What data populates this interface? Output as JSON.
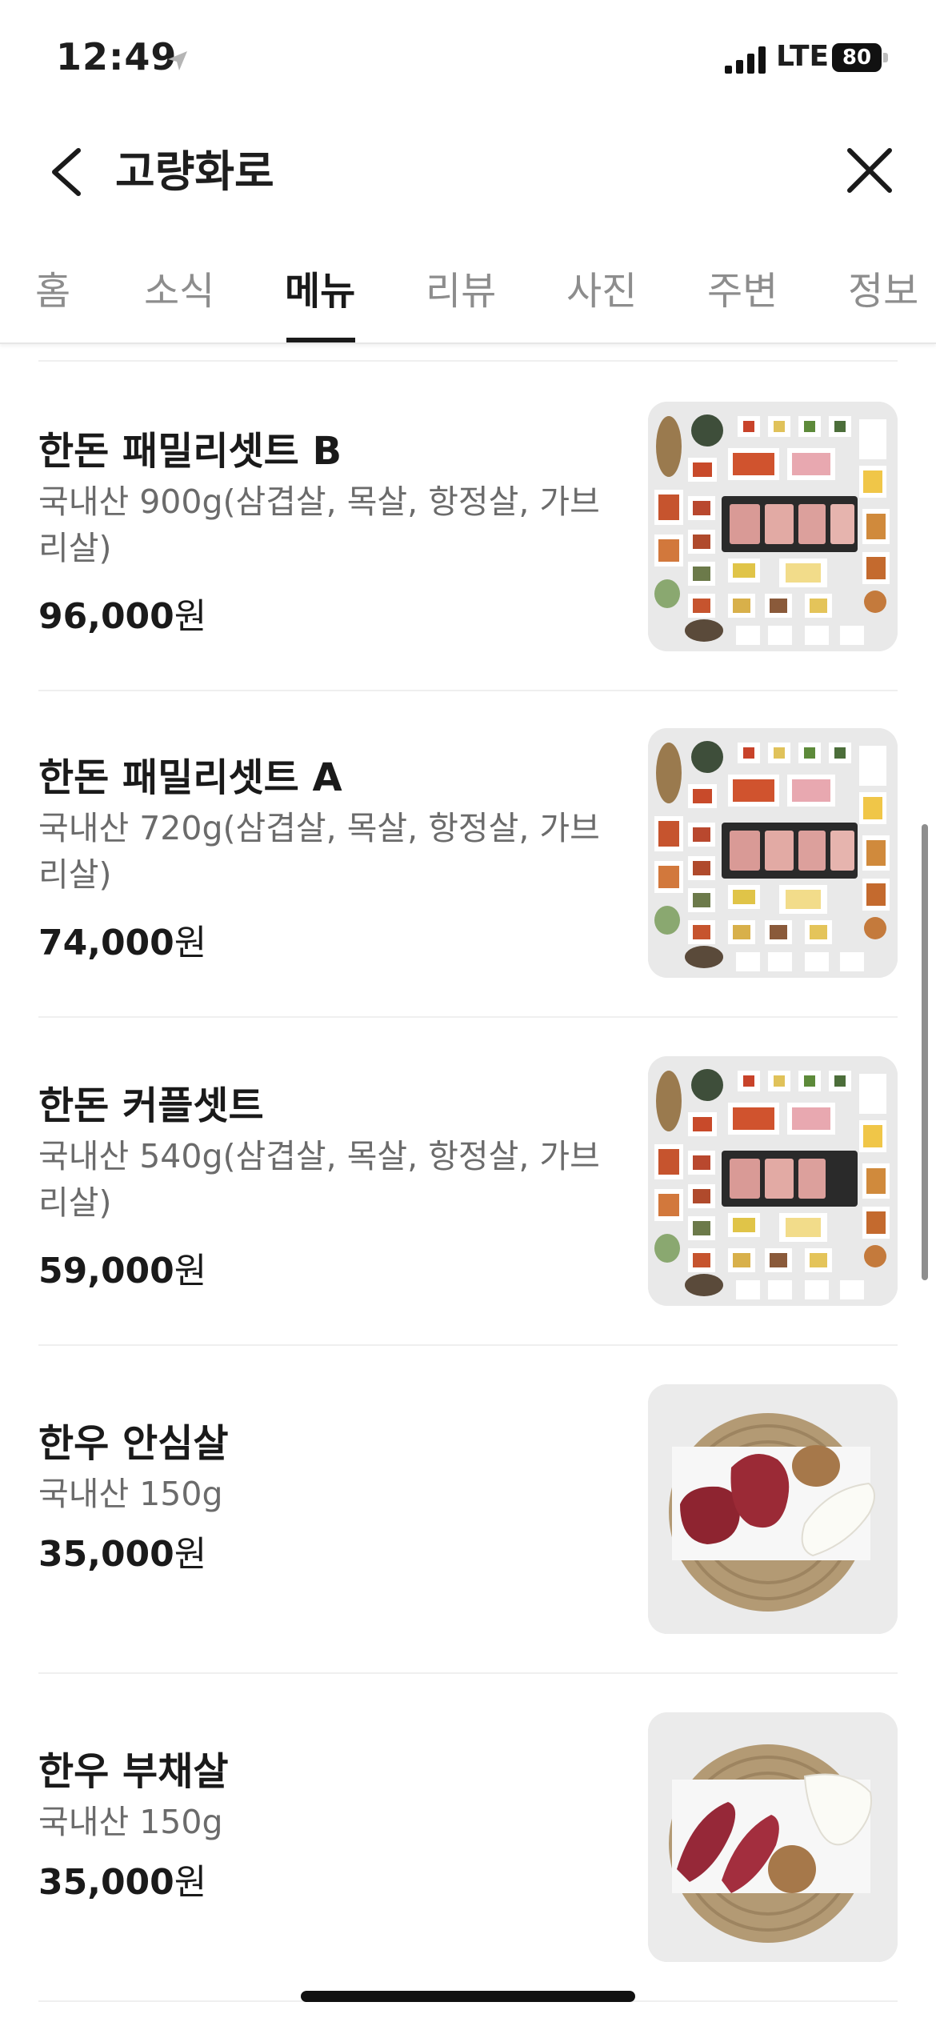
{
  "status_bar": {
    "time": "12:49",
    "network": "LTE",
    "battery": "80"
  },
  "header": {
    "title": "고량화로"
  },
  "tabs": [
    {
      "label": "홈"
    },
    {
      "label": "소식"
    },
    {
      "label": "메뉴"
    },
    {
      "label": "리뷰"
    },
    {
      "label": "사진"
    },
    {
      "label": "주변"
    },
    {
      "label": "정보"
    }
  ],
  "active_tab": "메뉴",
  "menu": [
    {
      "name": "한돈 패밀리셋트 B",
      "desc": "국내산 900g(삼겹살, 목살, 항정살, 가브리살)",
      "price": "96,000",
      "currency": "원",
      "photo": "set-platter"
    },
    {
      "name": "한돈 패밀리셋트 A",
      "desc": "국내산 720g(삼겹살, 목살, 항정살, 가브리살)",
      "price": "74,000",
      "currency": "원",
      "photo": "set-platter"
    },
    {
      "name": "한돈 커플셋트",
      "desc": "국내산 540g(삼겹살, 목살, 항정살, 가브리살)",
      "price": "59,000",
      "currency": "원",
      "photo": "set-platter"
    },
    {
      "name": "한우 안심살",
      "desc": "국내산 150g",
      "price": "35,000",
      "currency": "원",
      "photo": "beef-plate"
    },
    {
      "name": "한우 부채살",
      "desc": "국내산 150g",
      "price": "35,000",
      "currency": "원",
      "photo": "beef-plate"
    }
  ],
  "colors": {
    "text": "#1a1a1a",
    "muted": "#6b6b6b",
    "inactive_tab": "#8d8d8d",
    "divider": "#efefef"
  }
}
